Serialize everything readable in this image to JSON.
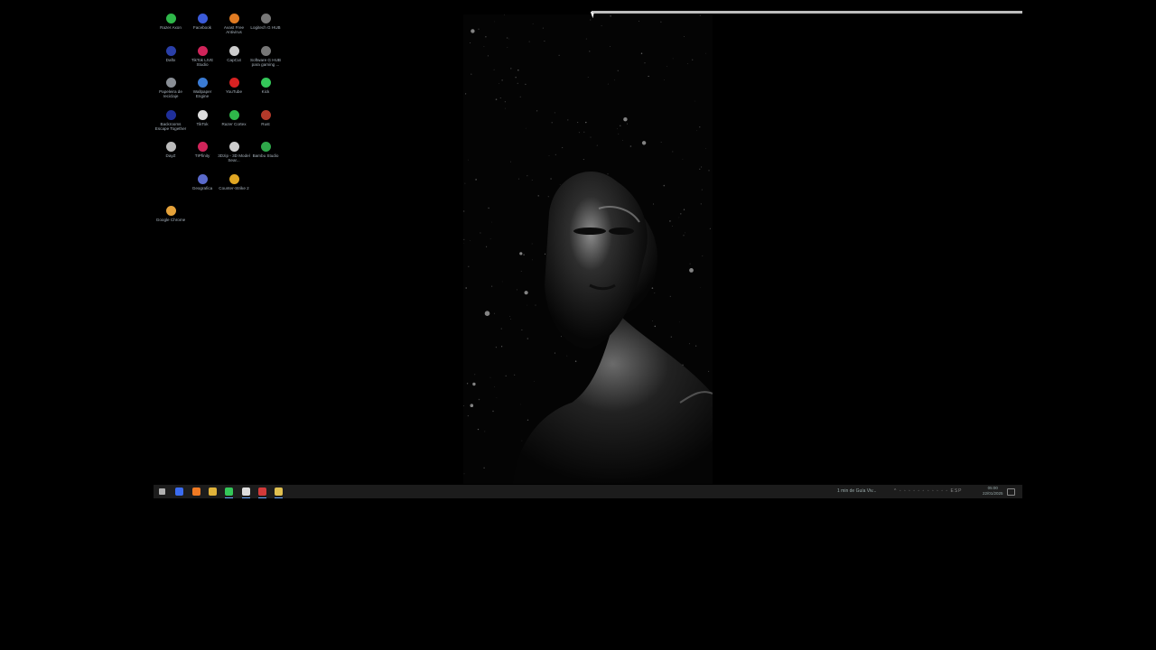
{
  "desktop": {
    "icons": [
      {
        "label": "Razer Axon",
        "icon": "razer-axon-icon",
        "color": "#2fb84a"
      },
      {
        "label": "Facebook",
        "icon": "facebook-icon",
        "color": "#3b5bd9"
      },
      {
        "label": "Avast Free Antivirus",
        "icon": "avast-icon",
        "color": "#e07b22"
      },
      {
        "label": "Logitech G HUB",
        "icon": "logitech-icon",
        "color": "#777777"
      },
      {
        "label": "Daftx",
        "icon": "daftx-icon",
        "color": "#2a3fa8"
      },
      {
        "label": "TikTok LIVE Studio",
        "icon": "tiktok-live-icon",
        "color": "#d0245a"
      },
      {
        "label": "CapCut",
        "icon": "capcut-icon",
        "color": "#cccccc"
      },
      {
        "label": "Software G HUB para gaming ...",
        "icon": "ghub-icon",
        "color": "#777777"
      },
      {
        "label": "Papeleira de reciclaje",
        "icon": "recycle-bin-icon",
        "color": "#8a8f96"
      },
      {
        "label": "Wallpaper Engine",
        "icon": "wallpaper-engine-icon",
        "color": "#3a7bd5"
      },
      {
        "label": "YouTube",
        "icon": "youtube-icon",
        "color": "#d72222"
      },
      {
        "label": "Kick",
        "icon": "kick-icon",
        "color": "#34c759"
      },
      {
        "label": "Backrooms Escape Together",
        "icon": "backrooms-icon",
        "color": "#1f2f9a"
      },
      {
        "label": "TikTok",
        "icon": "tiktok-icon",
        "color": "#dddddd"
      },
      {
        "label": "Razer Cortex",
        "icon": "razer-cortex-icon",
        "color": "#2fb84a"
      },
      {
        "label": "Rust",
        "icon": "rust-icon",
        "color": "#b23a2a"
      },
      {
        "label": "DayZ",
        "icon": "dayz-icon",
        "color": "#bbbbbb"
      },
      {
        "label": "TIPfinity",
        "icon": "tipfinity-icon",
        "color": "#d0245a"
      },
      {
        "label": "3Dzip - 3D Model Sear...",
        "icon": "3dzip-icon",
        "color": "#cfcfcf"
      },
      {
        "label": "Bambu Studio",
        "icon": "bambu-icon",
        "color": "#2fa84a"
      },
      {
        "label": "Geografica",
        "icon": "geografica-icon",
        "color": "#5a6acb"
      },
      {
        "label": "Counter-Strike 2",
        "icon": "cs2-icon",
        "color": "#e0a623"
      },
      {
        "label": "Google Chrome",
        "icon": "chrome-icon",
        "color": "#e5a23a"
      }
    ]
  },
  "taskbar": {
    "items": [
      {
        "icon": "windows-start-icon",
        "color": "#b0b0b0"
      },
      {
        "icon": "chrome-taskbar-icon",
        "color": "#3b6cf0"
      },
      {
        "icon": "browser-taskbar-icon",
        "color": "#f07a23"
      },
      {
        "icon": "file-explorer-icon",
        "color": "#e0b33a"
      },
      {
        "icon": "kick-taskbar-icon",
        "color": "#34c759"
      },
      {
        "icon": "app-taskbar-icon",
        "color": "#dddddd"
      },
      {
        "icon": "record-taskbar-icon",
        "color": "#d23a3a"
      },
      {
        "icon": "notepad-taskbar-icon",
        "color": "#e0c050"
      }
    ],
    "weather_text": "1 min de Guía Viv...",
    "tray_text": "^ ◦ ◦ ◦ ◦ ◦ ◦ ◦ ◦ ◦ ◦ ◦",
    "lang": "ESP",
    "time": "05:00",
    "date": "22/01/2025"
  }
}
